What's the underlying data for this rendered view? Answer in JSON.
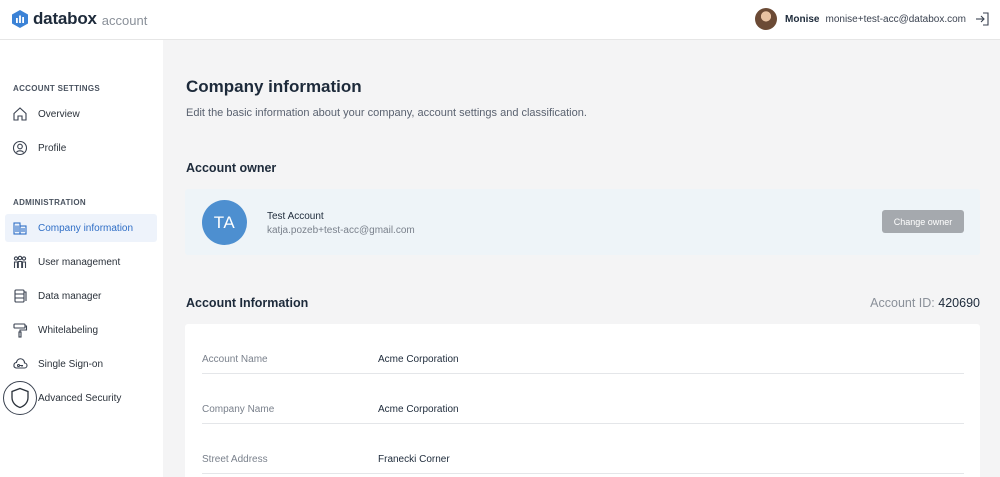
{
  "header": {
    "brand": "databox",
    "brand_sub": "account",
    "user_name": "Monise",
    "user_email": "monise+test-acc@databox.com"
  },
  "sidebar": {
    "sections": [
      {
        "title": "ACCOUNT SETTINGS",
        "items": [
          {
            "label": "Overview",
            "icon": "home-icon"
          },
          {
            "label": "Profile",
            "icon": "user-circle-icon"
          }
        ]
      },
      {
        "title": "ADMINISTRATION",
        "items": [
          {
            "label": "Company information",
            "icon": "building-icon",
            "active": true
          },
          {
            "label": "User management",
            "icon": "users-icon"
          },
          {
            "label": "Data manager",
            "icon": "database-icon"
          },
          {
            "label": "Whitelabeling",
            "icon": "paint-roller-icon"
          },
          {
            "label": "Single Sign-on",
            "icon": "cloud-key-icon"
          },
          {
            "label": "Advanced Security",
            "icon": "shield-icon"
          }
        ]
      }
    ]
  },
  "main": {
    "title": "Company information",
    "description": "Edit the basic information about your company, account settings and classification.",
    "owner_heading": "Account owner",
    "owner": {
      "initials": "TA",
      "name": "Test Account",
      "email": "katja.pozeb+test-acc@gmail.com",
      "button": "Change owner"
    },
    "info_heading": "Account Information",
    "account_id_label": "Account ID:",
    "account_id": "420690",
    "rows": [
      {
        "label": "Account Name",
        "value": "Acme Corporation"
      },
      {
        "label": "Company Name",
        "value": "Acme Corporation"
      },
      {
        "label": "Street Address",
        "value": "Franecki Corner"
      }
    ]
  },
  "colors": {
    "accent": "#2f6ec6",
    "avatar": "#4d8fd0",
    "brand_logo": "#3b82d6"
  }
}
